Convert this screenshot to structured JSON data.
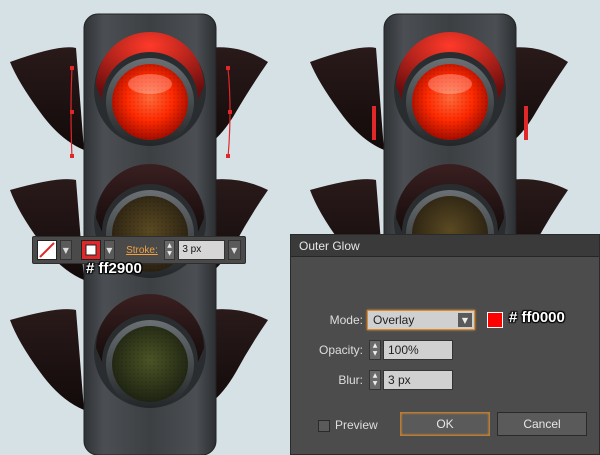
{
  "toolbar": {
    "stroke_label": "Stroke:",
    "stroke_value": "3 px",
    "fill_icon": "no-fill-slash-icon",
    "stroke_icon": "stroke-swatch-icon"
  },
  "annotations": {
    "left_color": "# ff2900",
    "right_color": "# ff0000"
  },
  "dialog": {
    "title": "Outer Glow",
    "mode_label": "Mode:",
    "mode_value": "Overlay",
    "opacity_label": "Opacity:",
    "opacity_value": "100%",
    "blur_label": "Blur:",
    "blur_value": "3 px",
    "preview_label": "Preview",
    "ok_label": "OK",
    "cancel_label": "Cancel",
    "glow_color": "#ff0000"
  },
  "colors": {
    "red_light": "#ff2900",
    "stroke_color": "#e0272a",
    "glow": "#ff0000",
    "accent": "#f0a040"
  }
}
